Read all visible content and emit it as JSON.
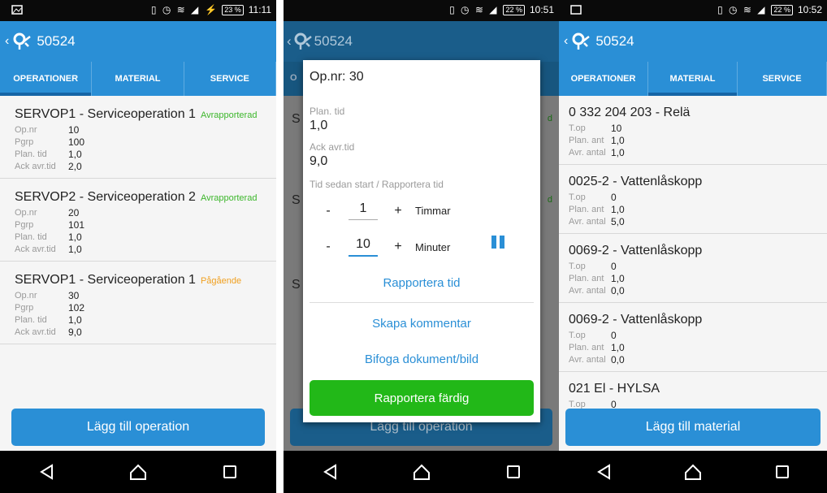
{
  "status_bars": [
    {
      "time": "11:11",
      "battery": "23 %"
    },
    {
      "time": "10:51",
      "battery": "22 %"
    },
    {
      "time": "10:52",
      "battery": "22 %"
    }
  ],
  "app": {
    "title": "50524",
    "back": "‹"
  },
  "tabs": [
    "OPERATIONER",
    "MATERIAL",
    "SERVICE"
  ],
  "operations": [
    {
      "title": "SERVOP1 - Serviceoperation 1",
      "status": "Avrapporterad",
      "status_type": "done",
      "fields": [
        {
          "label": "Op.nr",
          "value": "10"
        },
        {
          "label": "Pgrp",
          "value": "100"
        },
        {
          "label": "Plan. tid",
          "value": "1,0"
        },
        {
          "label": "Ack avr.tid",
          "value": "2,0"
        }
      ]
    },
    {
      "title": "SERVOP2 - Serviceoperation 2",
      "status": "Avrapporterad",
      "status_type": "done",
      "fields": [
        {
          "label": "Op.nr",
          "value": "20"
        },
        {
          "label": "Pgrp",
          "value": "101"
        },
        {
          "label": "Plan. tid",
          "value": "1,0"
        },
        {
          "label": "Ack avr.tid",
          "value": "1,0"
        }
      ]
    },
    {
      "title": "SERVOP1 - Serviceoperation 1",
      "status": "Pågående",
      "status_type": "active",
      "fields": [
        {
          "label": "Op.nr",
          "value": "30"
        },
        {
          "label": "Pgrp",
          "value": "102"
        },
        {
          "label": "Plan. tid",
          "value": "1,0"
        },
        {
          "label": "Ack avr.tid",
          "value": "9,0"
        }
      ]
    }
  ],
  "add_operation_label": "Lägg till operation",
  "dialog": {
    "title": "Op.nr: 30",
    "plan_label": "Plan. tid",
    "plan_value": "1,0",
    "ack_label": "Ack avr.tid",
    "ack_value": "9,0",
    "time_label": "Tid sedan start / Rapportera tid",
    "hours_value": "1",
    "hours_unit": "Timmar",
    "minutes_value": "10",
    "minutes_unit": "Minuter",
    "minus": "-",
    "plus": "+",
    "report_time": "Rapportera tid",
    "create_comment": "Skapa kommentar",
    "attach": "Bifoga dokument/bild",
    "report_done": "Rapportera färdig"
  },
  "bg_fragments": [
    "S",
    "S",
    "S"
  ],
  "bg_fragment_status": "d",
  "bg_tab_fragment": "O",
  "materials": [
    {
      "title": "0 332 204 203 - Relä",
      "fields": [
        {
          "label": "T.op",
          "value": "10"
        },
        {
          "label": "Plan. ant",
          "value": "1,0"
        },
        {
          "label": "Avr. antal",
          "value": "1,0"
        }
      ]
    },
    {
      "title": "0025-2 - Vattenlåskopp",
      "fields": [
        {
          "label": "T.op",
          "value": "0"
        },
        {
          "label": "Plan. ant",
          "value": "1,0"
        },
        {
          "label": "Avr. antal",
          "value": "5,0"
        }
      ]
    },
    {
      "title": "0069-2 - Vattenlåskopp",
      "fields": [
        {
          "label": "T.op",
          "value": "0"
        },
        {
          "label": "Plan. ant",
          "value": "1,0"
        },
        {
          "label": "Avr. antal",
          "value": "0,0"
        }
      ]
    },
    {
      "title": "0069-2 - Vattenlåskopp",
      "fields": [
        {
          "label": "T.op",
          "value": "0"
        },
        {
          "label": "Plan. ant",
          "value": "1,0"
        },
        {
          "label": "Avr. antal",
          "value": "0,0"
        }
      ]
    },
    {
      "title": "021 El - HYLSA",
      "fields": [
        {
          "label": "T.op",
          "value": "0"
        }
      ]
    }
  ],
  "add_material_label": "Lägg till material",
  "colors": {
    "primary": "#2a8fd6",
    "done": "#3db72c",
    "active": "#f0a020",
    "report_done_bg": "#22b818"
  },
  "icons": {
    "back": "back-icon",
    "triangle": "nav-back-icon",
    "circle": "nav-home-icon",
    "square": "nav-recents-icon",
    "pause": "pause-icon"
  }
}
